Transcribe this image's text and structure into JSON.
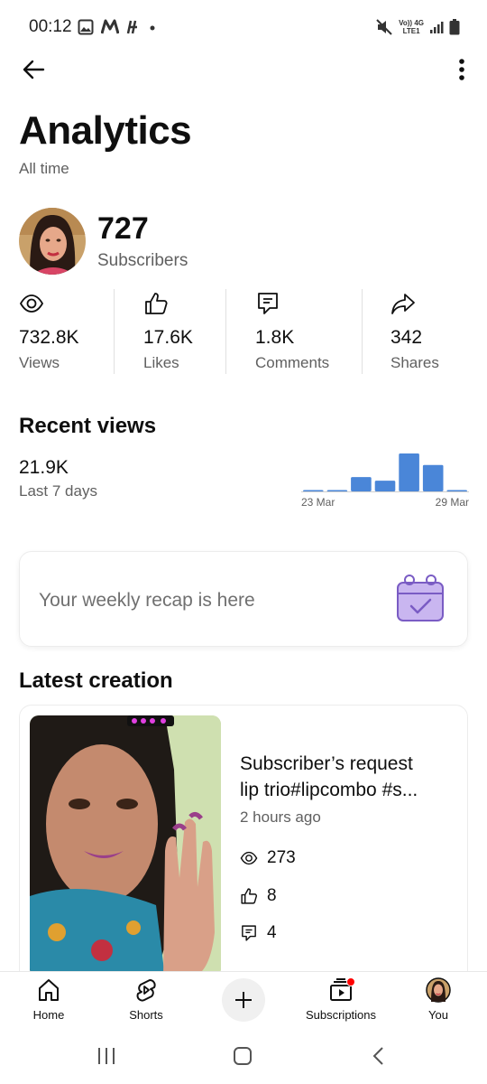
{
  "status_bar": {
    "time": "00:12",
    "network_top": "Vo)) 4G",
    "network_bottom": "LTE1"
  },
  "header": {
    "title": "Analytics",
    "subtitle": "All time"
  },
  "channel": {
    "subscriber_count": "727",
    "subscriber_label": "Subscribers"
  },
  "stats": [
    {
      "icon": "eye-icon",
      "value": "732.8K",
      "label": "Views"
    },
    {
      "icon": "thumbs-up-icon",
      "value": "17.6K",
      "label": "Likes"
    },
    {
      "icon": "comment-icon",
      "value": "1.8K",
      "label": "Comments"
    },
    {
      "icon": "share-arrow-icon",
      "value": "342",
      "label": "Shares"
    }
  ],
  "recent_views": {
    "title": "Recent views",
    "value": "21.9K",
    "period": "Last 7 days",
    "start_label": "23 Mar",
    "end_label": "29 Mar"
  },
  "chart_data": {
    "type": "bar",
    "categories": [
      "23 Mar",
      "24 Mar",
      "25 Mar",
      "26 Mar",
      "27 Mar",
      "28 Mar",
      "29 Mar"
    ],
    "values": [
      0.2,
      0.3,
      3.6,
      2.7,
      9.5,
      6.6,
      0.3
    ],
    "color": "#4a86d8"
  },
  "recap": {
    "text": "Your weekly recap is here",
    "icon": "calendar-check-icon"
  },
  "latest": {
    "title": "Latest creation",
    "video_title_line1": "Subscriber’s request",
    "video_title_line2": "lip trio#lipcombo #s...",
    "time_ago": "2 hours ago",
    "views": "273",
    "likes": "8",
    "comments": "4"
  },
  "bottom_nav": {
    "home": "Home",
    "shorts": "Shorts",
    "subscriptions": "Subscriptions",
    "you": "You"
  },
  "colors": {
    "accent_bar": "#4a86d8",
    "notification": "#ff0000",
    "recap_icon": "#c9b6f0"
  }
}
